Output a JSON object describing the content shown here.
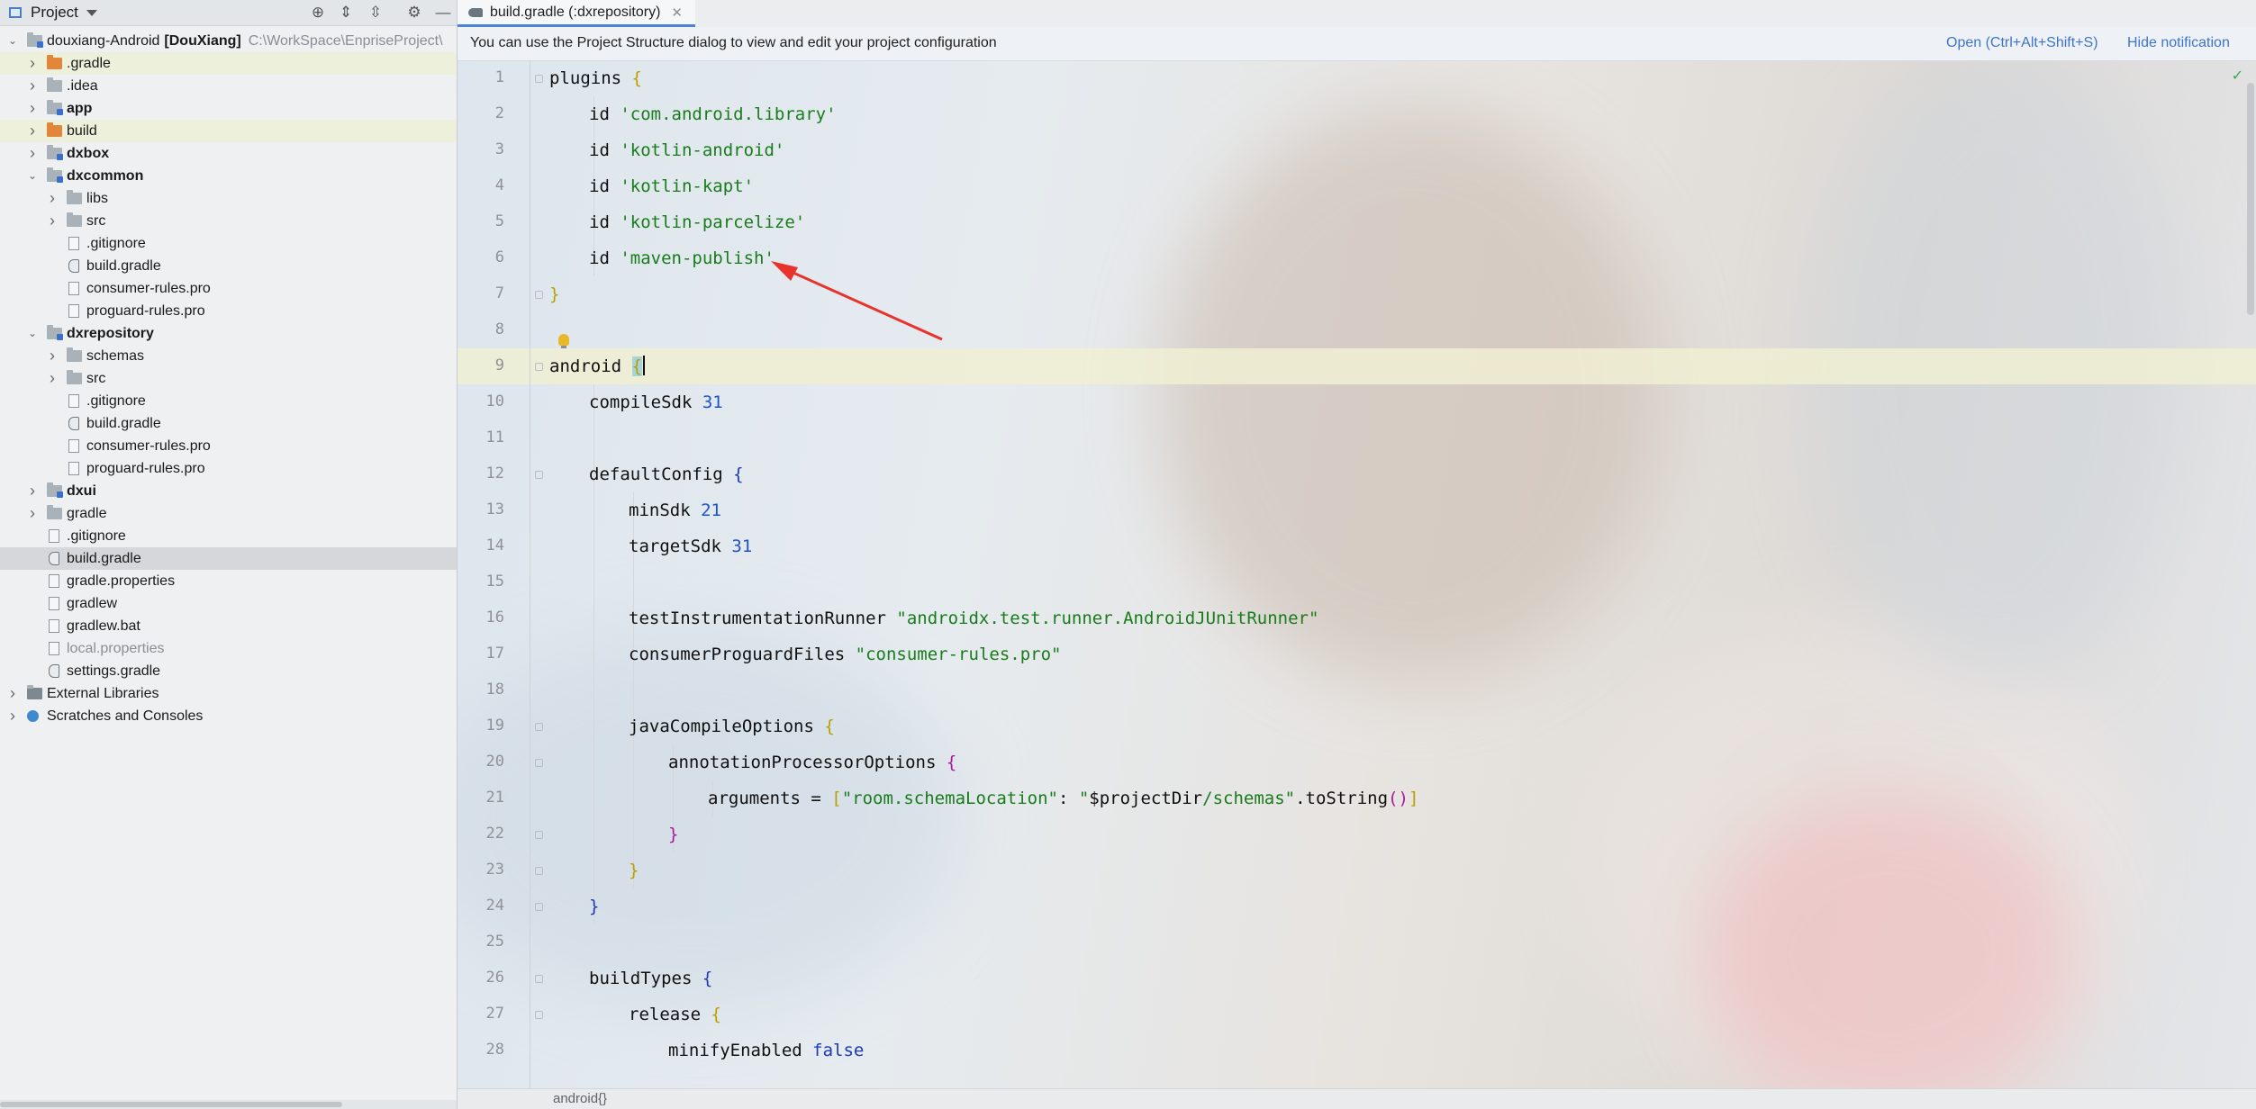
{
  "project_panel": {
    "title": "Project",
    "tree": [
      {
        "label": "douxiang-Android",
        "suffix": "[DouXiang]",
        "path": "C:\\WorkSpace\\EnpriseProject\\",
        "depth": 0,
        "arrow": "open",
        "icon": "folder-module",
        "bold": false,
        "hl": "none"
      },
      {
        "label": ".gradle",
        "depth": 1,
        "arrow": "closed",
        "icon": "folder-orange",
        "hl": "yellow"
      },
      {
        "label": ".idea",
        "depth": 1,
        "arrow": "closed",
        "icon": "folder"
      },
      {
        "label": "app",
        "depth": 1,
        "arrow": "closed",
        "icon": "folder-module",
        "bold": true
      },
      {
        "label": "build",
        "depth": 1,
        "arrow": "closed",
        "icon": "folder-orange",
        "hl": "yellow"
      },
      {
        "label": "dxbox",
        "depth": 1,
        "arrow": "closed",
        "icon": "folder-module",
        "bold": true
      },
      {
        "label": "dxcommon",
        "depth": 1,
        "arrow": "open",
        "icon": "folder-module",
        "bold": true
      },
      {
        "label": "libs",
        "depth": 2,
        "arrow": "closed",
        "icon": "folder"
      },
      {
        "label": "src",
        "depth": 2,
        "arrow": "closed",
        "icon": "folder"
      },
      {
        "label": ".gitignore",
        "depth": 2,
        "arrow": "none",
        "icon": "file"
      },
      {
        "label": "build.gradle",
        "depth": 2,
        "arrow": "none",
        "icon": "gradle"
      },
      {
        "label": "consumer-rules.pro",
        "depth": 2,
        "arrow": "none",
        "icon": "file"
      },
      {
        "label": "proguard-rules.pro",
        "depth": 2,
        "arrow": "none",
        "icon": "file"
      },
      {
        "label": "dxrepository",
        "depth": 1,
        "arrow": "open",
        "icon": "folder-module",
        "bold": true
      },
      {
        "label": "schemas",
        "depth": 2,
        "arrow": "closed",
        "icon": "folder"
      },
      {
        "label": "src",
        "depth": 2,
        "arrow": "closed",
        "icon": "folder"
      },
      {
        "label": ".gitignore",
        "depth": 2,
        "arrow": "none",
        "icon": "file"
      },
      {
        "label": "build.gradle",
        "depth": 2,
        "arrow": "none",
        "icon": "gradle"
      },
      {
        "label": "consumer-rules.pro",
        "depth": 2,
        "arrow": "none",
        "icon": "file"
      },
      {
        "label": "proguard-rules.pro",
        "depth": 2,
        "arrow": "none",
        "icon": "file"
      },
      {
        "label": "dxui",
        "depth": 1,
        "arrow": "closed",
        "icon": "folder-module",
        "bold": true
      },
      {
        "label": "gradle",
        "depth": 1,
        "arrow": "closed",
        "icon": "folder"
      },
      {
        "label": ".gitignore",
        "depth": 1,
        "arrow": "none",
        "icon": "file"
      },
      {
        "label": "build.gradle",
        "depth": 1,
        "arrow": "none",
        "icon": "gradle",
        "hl": "selected"
      },
      {
        "label": "gradle.properties",
        "depth": 1,
        "arrow": "none",
        "icon": "file"
      },
      {
        "label": "gradlew",
        "depth": 1,
        "arrow": "none",
        "icon": "file"
      },
      {
        "label": "gradlew.bat",
        "depth": 1,
        "arrow": "none",
        "icon": "file"
      },
      {
        "label": "local.properties",
        "depth": 1,
        "arrow": "none",
        "icon": "file",
        "muted": true
      },
      {
        "label": "settings.gradle",
        "depth": 1,
        "arrow": "none",
        "icon": "gradle"
      },
      {
        "label": "External Libraries",
        "depth": 0,
        "arrow": "closed",
        "icon": "lib"
      },
      {
        "label": "Scratches and Consoles",
        "depth": 0,
        "arrow": "closed",
        "icon": "scratch"
      }
    ]
  },
  "editor": {
    "tab_label": "build.gradle (:dxrepository)",
    "notification": {
      "message": "You can use the Project Structure dialog to view and edit your project configuration",
      "open_link": "Open (Ctrl+Alt+Shift+S)",
      "hide_link": "Hide notification"
    },
    "line_numbers": [
      "1",
      "2",
      "3",
      "4",
      "5",
      "6",
      "7",
      "8",
      "9",
      "10",
      "11",
      "12",
      "13",
      "14",
      "15",
      "16",
      "17",
      "18",
      "19",
      "20",
      "21",
      "22",
      "23",
      "24",
      "25",
      "26",
      "27",
      "28"
    ],
    "breadcrumb": "android{}",
    "code": {
      "l1_kw": "plugins",
      "l1_b": "{",
      "l2_a": "id ",
      "l2_s": "'com.android.library'",
      "l3_a": "id ",
      "l3_s": "'kotlin-android'",
      "l4_a": "id ",
      "l4_s": "'kotlin-kapt'",
      "l5_a": "id ",
      "l5_s": "'kotlin-parcelize'",
      "l6_a": "id ",
      "l6_s": "'maven-publish'",
      "l7_b": "}",
      "l9_kw": "android ",
      "l9_b": "{",
      "l10_a": "compileSdk ",
      "l10_n": "31",
      "l12_a": "defaultConfig ",
      "l12_b": "{",
      "l13_a": "minSdk ",
      "l13_n": "21",
      "l14_a": "targetSdk ",
      "l14_n": "31",
      "l16_a": "testInstrumentationRunner ",
      "l16_s": "\"androidx.test.runner.AndroidJUnitRunner\"",
      "l17_a": "consumerProguardFiles ",
      "l17_s": "\"consumer-rules.pro\"",
      "l19_a": "javaCompileOptions ",
      "l19_b": "{",
      "l20_a": "annotationProcessorOptions ",
      "l20_b": "{",
      "l21_a": "arguments = ",
      "l21_b1": "[",
      "l21_s1": "\"room.schemaLocation\"",
      "l21_c": ": ",
      "l21_s2": "\"",
      "l21_v": "$projectDir",
      "l21_s3": "/schemas\"",
      "l21_d": ".toString",
      "l21_p": "()",
      "l21_b2": "]",
      "l22_b": "}",
      "l23_b": "}",
      "l24_b": "}",
      "l26_a": "buildTypes ",
      "l26_b": "{",
      "l27_a": "release ",
      "l27_b": "{",
      "l28_a": "minifyEnabled ",
      "l28_kw": "false"
    }
  },
  "colors": {
    "accent": "#4a84d6",
    "string": "#187c1b",
    "number": "#1d53c9",
    "annotation_arrow": "#e8322b"
  }
}
